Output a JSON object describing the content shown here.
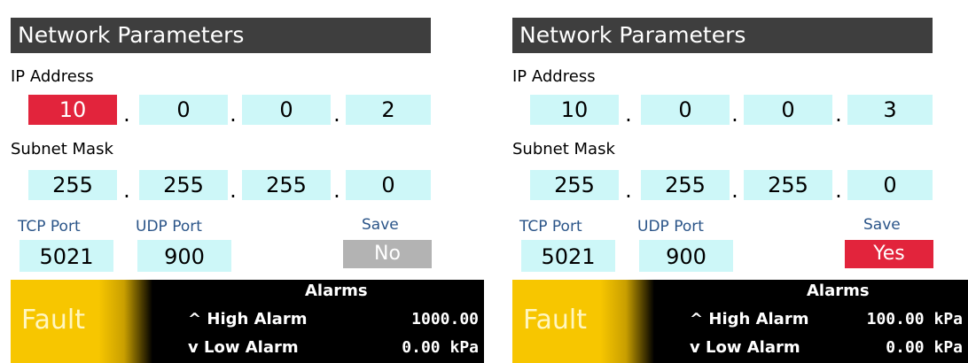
{
  "panels": [
    {
      "title": "Network Parameters",
      "ip_label": "IP Address",
      "ip": [
        "10",
        "0",
        "0",
        "2"
      ],
      "subnet_label": "Subnet Mask",
      "subnet": [
        "255",
        "255",
        "255",
        "0"
      ],
      "dot": ".",
      "tcp_label": "TCP Port",
      "tcp_value": "5021",
      "udp_label": "UDP Port",
      "udp_value": "900",
      "save_label": "Save",
      "save_value": "No",
      "status": "Fault",
      "alarms_title": "Alarms",
      "high_alarm_label": "High Alarm",
      "high_alarm_value": "1000.00",
      "low_alarm_label": "Low Alarm",
      "low_alarm_value": "0.00 kPa",
      "up_icon": "^",
      "down_icon": "v"
    },
    {
      "title": "Network Parameters",
      "ip_label": "IP Address",
      "ip": [
        "10",
        "0",
        "0",
        "3"
      ],
      "subnet_label": "Subnet Mask",
      "subnet": [
        "255",
        "255",
        "255",
        "0"
      ],
      "dot": ".",
      "tcp_label": "TCP Port",
      "tcp_value": "5021",
      "udp_label": "UDP Port",
      "udp_value": "900",
      "save_label": "Save",
      "save_value": "Yes",
      "status": "Fault",
      "alarms_title": "Alarms",
      "high_alarm_label": "High Alarm",
      "high_alarm_value": "100.00 kPa",
      "low_alarm_label": "Low Alarm",
      "low_alarm_value": "0.00 kPa",
      "up_icon": "^",
      "down_icon": "v"
    }
  ],
  "colors": {
    "title_bg": "#3e3e3e",
    "field_bg": "#cdf7f8",
    "active_red": "#e2243c",
    "save_no_bg": "#b3b3b3",
    "port_label": "#2a5488",
    "fault_yellow": "#f7c600"
  }
}
